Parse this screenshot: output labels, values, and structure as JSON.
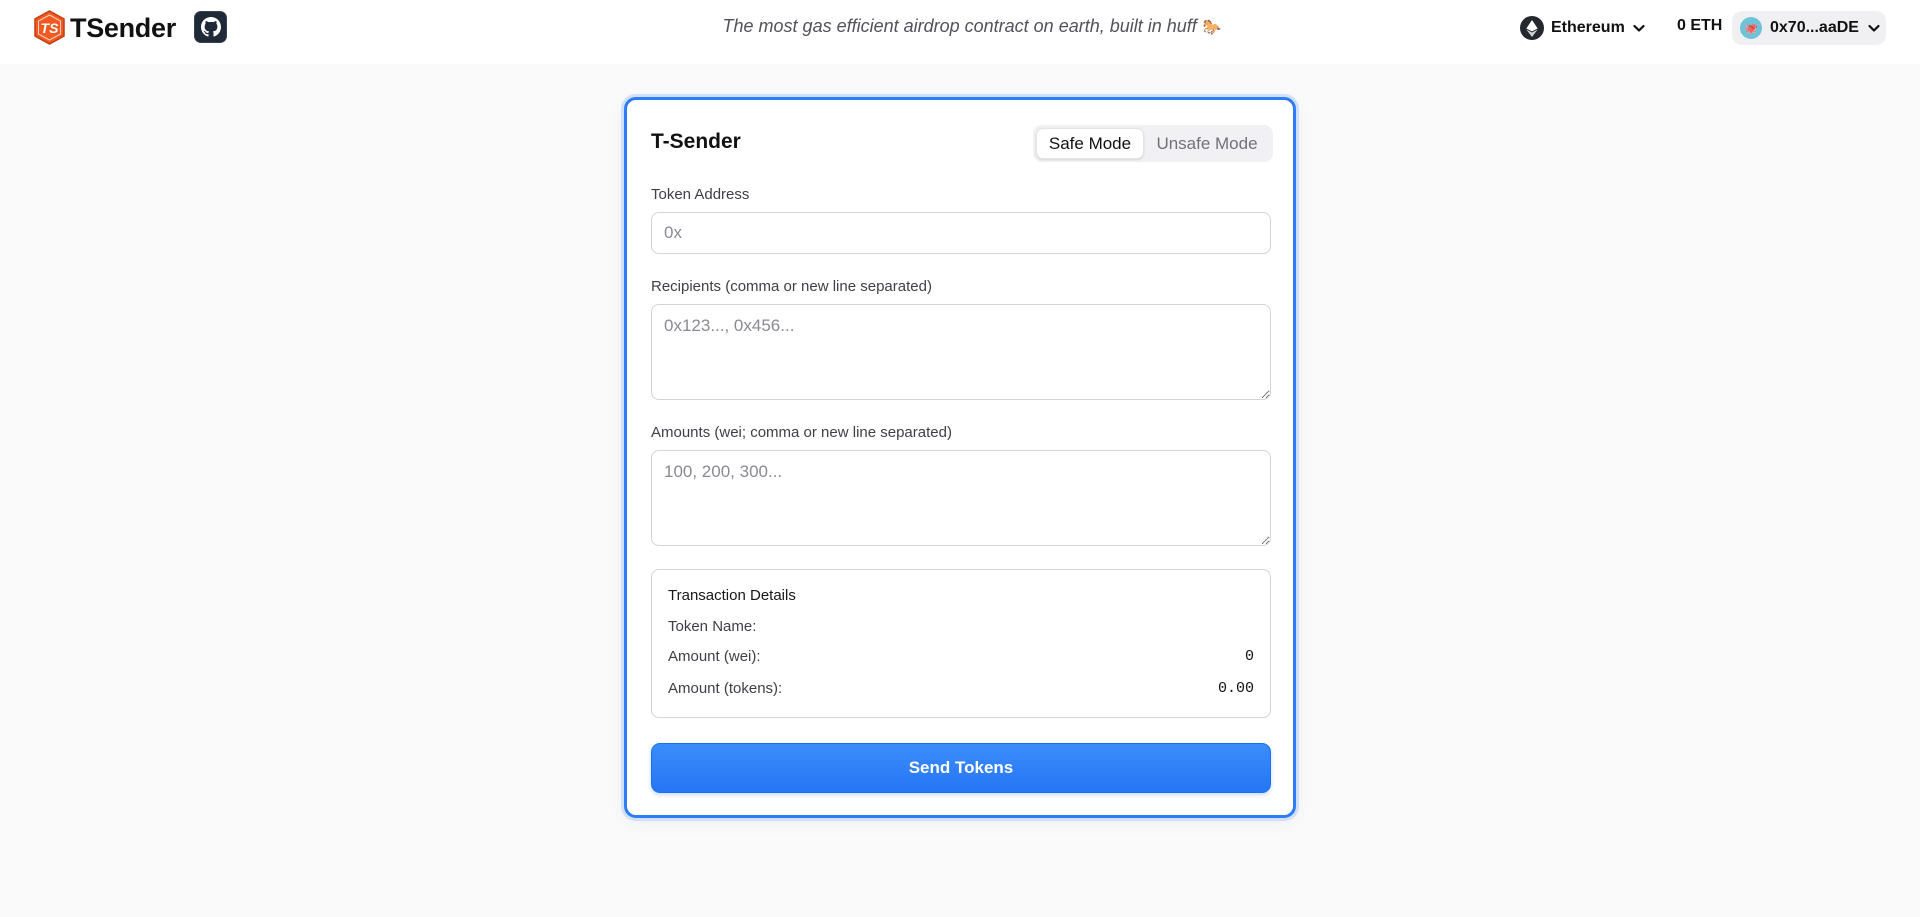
{
  "header": {
    "brand_name": "TSender",
    "logo_text": "TS",
    "tagline": "The most gas efficient airdrop contract on earth, built in huff",
    "tagline_emoji": "🐎",
    "network": {
      "label": "Ethereum",
      "icon": "ethereum-icon"
    },
    "balance": "0 ETH",
    "account": {
      "address": "0x70...aaDE",
      "avatar_emoji": "🐙"
    },
    "github_icon": "github-icon"
  },
  "card": {
    "title": "T-Sender",
    "modes": {
      "safe": "Safe Mode",
      "unsafe": "Unsafe Mode",
      "active": "safe"
    },
    "token_address": {
      "label": "Token Address",
      "placeholder": "0x",
      "value": ""
    },
    "recipients": {
      "label": "Recipients (comma or new line separated)",
      "placeholder": "0x123..., 0x456...",
      "value": ""
    },
    "amounts": {
      "label": "Amounts (wei; comma or new line separated)",
      "placeholder": "100, 200, 300...",
      "value": ""
    },
    "details": {
      "title": "Transaction Details",
      "token_name_label": "Token Name:",
      "token_name_value": "",
      "amount_wei_label": "Amount (wei):",
      "amount_wei_value": "0",
      "amount_tokens_label": "Amount (tokens):",
      "amount_tokens_value": "0.00"
    },
    "send_label": "Send Tokens"
  },
  "colors": {
    "accent": "#2f7df6",
    "logo": "#f05a22",
    "page_bg": "#fafafa"
  }
}
